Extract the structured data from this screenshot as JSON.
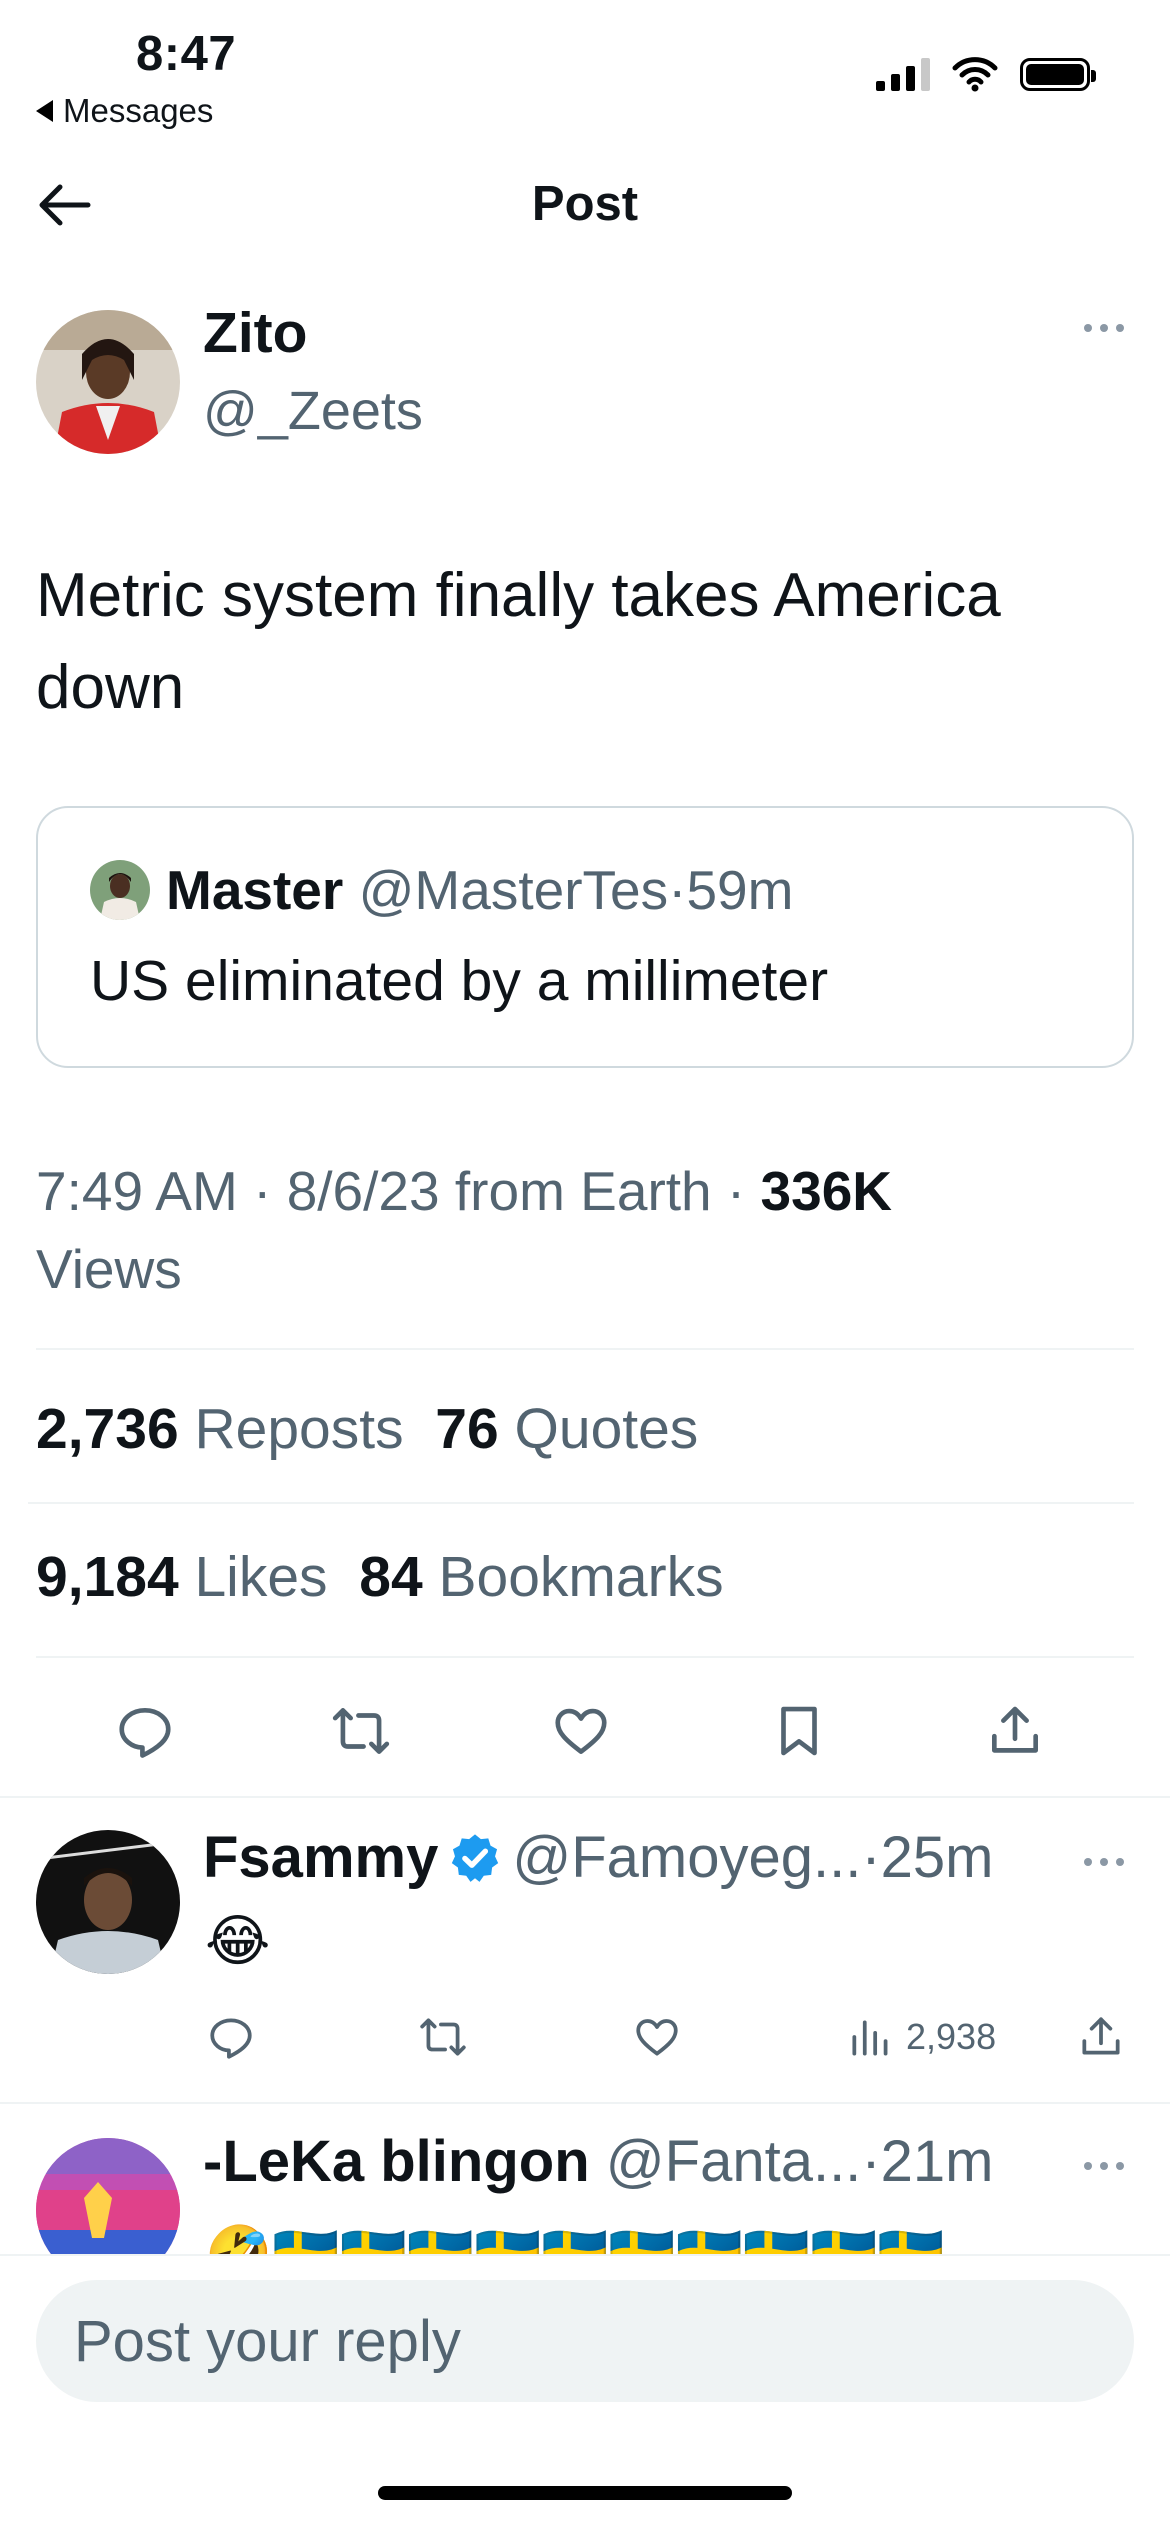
{
  "status_bar": {
    "time": "8:47",
    "back_app": "Messages"
  },
  "header": {
    "title": "Post"
  },
  "tweet": {
    "author_name": "Zito",
    "author_handle": "@_Zeets",
    "text": "Metric system finally takes America down",
    "quote": {
      "author_name": "Master",
      "author_handle": "@MasterTes",
      "separator": "·",
      "time": "59m",
      "text": "US eliminated by a millimeter"
    },
    "time": "7:49 AM",
    "date": "8/6/23",
    "source": "from Earth",
    "views_count": "336K",
    "views_label": "Views",
    "reposts_count": "2,736",
    "reposts_label": "Reposts",
    "quotes_count": "76",
    "quotes_label": "Quotes",
    "likes_count": "9,184",
    "likes_label": "Likes",
    "bookmarks_count": "84",
    "bookmarks_label": "Bookmarks"
  },
  "replies": [
    {
      "author_name": "Fsammy",
      "verified": true,
      "author_handle": "@Famoyeg...",
      "separator": "·",
      "time": "25m",
      "text": "😂",
      "views": "2,938"
    },
    {
      "author_name": "-LeKa blingon",
      "author_handle": "@Fanta...",
      "separator": "·",
      "time": "21m",
      "text": "🤣🇸🇪🇸🇪🇸🇪🇸🇪🇸🇪🇸🇪🇸🇪🇸🇪🇸🇪🇸🇪"
    }
  ],
  "composer": {
    "placeholder": "Post your reply"
  },
  "colors": {
    "text": "#0f1419",
    "muted": "#536471",
    "verified": "#1d9bf0",
    "divider": "#eff3f4"
  },
  "icons": [
    "back-arrow-icon",
    "more-icon",
    "reply-icon",
    "repost-icon",
    "like-icon",
    "bookmark-icon",
    "share-icon",
    "views-icon",
    "verified-icon"
  ]
}
